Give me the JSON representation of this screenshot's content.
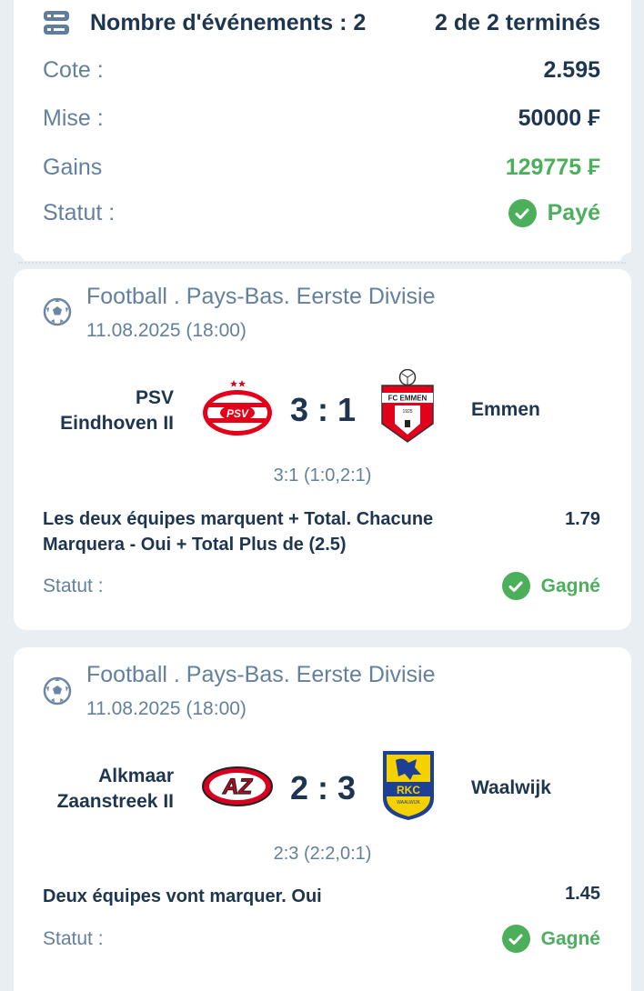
{
  "summary": {
    "events_label": "Nombre d'événements : 2",
    "completed": "2 de 2 terminés",
    "rows": [
      {
        "label": "Cote :",
        "value": "2.595"
      },
      {
        "label": "Mise :",
        "value": "50000 ₣"
      },
      {
        "label": "Gains",
        "value": "129775 ₣"
      },
      {
        "label": "Statut :",
        "value": "Payé"
      }
    ]
  },
  "events": [
    {
      "league": "Football . Pays-Bas. Eerste Divisie",
      "date": "11.08.2025 (18:00)",
      "home_line1": "PSV",
      "home_line2": "Eindhoven II",
      "away": "Emmen",
      "score": "3 : 1",
      "score_detail": "3:1 (1:0,2:1)",
      "market": "Les deux équipes marquent + Total. Chacune Marquera - Oui + Total Plus de (2.5)",
      "odd": "1.79",
      "status_label": "Statut :",
      "status": "Gagné"
    },
    {
      "league": "Football . Pays-Bas. Eerste Divisie",
      "date": "11.08.2025 (18:00)",
      "home_line1": "Alkmaar",
      "home_line2": "Zaanstreek II",
      "away": "Waalwijk",
      "score": "2 : 3",
      "score_detail": "2:3 (2:2,0:1)",
      "market": "Deux équipes vont marquer. Oui",
      "odd": "1.45",
      "status_label": "Statut :",
      "status": "Gagné"
    }
  ],
  "logos": {
    "psv": "PSV",
    "emmen": "FC EMMEN",
    "emmen_year": "1925",
    "az": "AZ",
    "rkc": "RKC",
    "rkc_sub": "WAALWIJK"
  },
  "colors": {
    "text_dark": "#1e3550",
    "text_muted": "#63809e",
    "green": "#4caf5b",
    "background": "#e9eef3",
    "card": "#ffffff",
    "psv_red": "#e2001a",
    "az_red": "#d8001e",
    "rkc_yellow": "#f5d100",
    "rkc_blue": "#1d3f94"
  }
}
